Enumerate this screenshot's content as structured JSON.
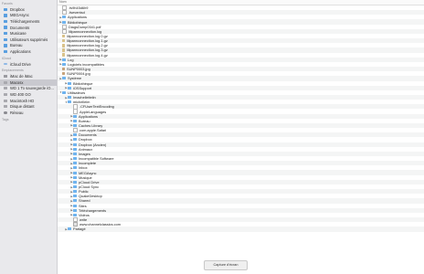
{
  "sidebar": {
    "sections": [
      {
        "label": "Favoris",
        "items": [
          {
            "label": "Dropbox",
            "icon": "folder-icon"
          },
          {
            "label": "MEGAsync",
            "icon": "folder-icon"
          },
          {
            "label": "Téléchargements",
            "icon": "download-icon"
          },
          {
            "label": "Documents",
            "icon": "document-icon"
          },
          {
            "label": "Musicase",
            "icon": "folder-icon"
          },
          {
            "label": "Utilisateurs supprimés",
            "icon": "folder-icon"
          },
          {
            "label": "Bureau",
            "icon": "desktop-icon"
          },
          {
            "label": "Applications",
            "icon": "applications-icon"
          }
        ]
      },
      {
        "label": "iCloud",
        "items": [
          {
            "label": "iCloud Drive",
            "icon": "cloud-icon"
          }
        ]
      },
      {
        "label": "Emplacements",
        "items": [
          {
            "label": "iMac de iMac",
            "icon": "computer-icon"
          },
          {
            "label": "Macosx",
            "icon": "disk-icon",
            "selected": true
          },
          {
            "label": "WD 1 To sauvegarde iO...",
            "icon": "disk-icon"
          },
          {
            "label": "WD 400 GO",
            "icon": "disk-icon"
          },
          {
            "label": "Macintosh HD",
            "icon": "disk-icon"
          },
          {
            "label": "Disque distant",
            "icon": "disk-icon"
          },
          {
            "label": "Réseau",
            "icon": "network-icon"
          }
        ]
      },
      {
        "label": "Tags",
        "items": []
      }
    ]
  },
  "header": {
    "name_column": "Nom"
  },
  "rows": [
    {
      "indent": 0,
      "disc": "",
      "icon": "file",
      "name": ".fs9h45d6h9"
    },
    {
      "indent": 0,
      "disc": "",
      "icon": "file",
      "name": ".fseventsd"
    },
    {
      "indent": 0,
      "disc": "▶",
      "icon": "folder",
      "name": "Applications"
    },
    {
      "indent": 0,
      "disc": "▶",
      "icon": "folder",
      "name": "Bibliothèque"
    },
    {
      "indent": 0,
      "disc": "",
      "icon": "file",
      "name": "DiagsDump0341.pdf"
    },
    {
      "indent": 0,
      "disc": "",
      "icon": "file",
      "name": "lilipanrconnection.log"
    },
    {
      "indent": 0,
      "disc": "",
      "icon": "archive",
      "name": "lilipanrconnection.log.0.gz"
    },
    {
      "indent": 0,
      "disc": "",
      "icon": "archive",
      "name": "lilipanrconnection.log.1.gz"
    },
    {
      "indent": 0,
      "disc": "",
      "icon": "archive",
      "name": "lilipanrconnection.log.2.gz"
    },
    {
      "indent": 0,
      "disc": "",
      "icon": "archive",
      "name": "lilipanrconnection.log.3.gz"
    },
    {
      "indent": 0,
      "disc": "",
      "icon": "archive",
      "name": "lilipanrconnection.log.4.gz"
    },
    {
      "indent": 0,
      "disc": "▶",
      "icon": "folder",
      "name": "Log"
    },
    {
      "indent": 0,
      "disc": "▶",
      "icon": "folder",
      "name": "Logiciels incompatibles"
    },
    {
      "indent": 0,
      "disc": "",
      "icon": "image",
      "name": "SUNP0003.jpg"
    },
    {
      "indent": 0,
      "disc": "",
      "icon": "image",
      "name": "SUNP0004.jpg"
    },
    {
      "indent": 0,
      "disc": "▶",
      "icon": "folder",
      "name": "Système"
    },
    {
      "indent": 1,
      "disc": "▶",
      "icon": "folder",
      "name": "Bibliothèque"
    },
    {
      "indent": 1,
      "disc": "▶",
      "icon": "folder",
      "name": "iOSSupport"
    },
    {
      "indent": 0,
      "disc": "▼",
      "icon": "folder",
      "name": "Utilisateurs"
    },
    {
      "indent": 1,
      "disc": "▶",
      "icon": "folder",
      "name": "Imachelleiteiin"
    },
    {
      "indent": 1,
      "disc": "▼",
      "icon": "folder",
      "name": "michelleim"
    },
    {
      "indent": 2,
      "disc": "",
      "icon": "file",
      "name": ".CFUserTextEncoding"
    },
    {
      "indent": 2,
      "disc": "",
      "icon": "file",
      "name": "AppleLanguages"
    },
    {
      "indent": 2,
      "disc": "▶",
      "icon": "folder",
      "name": "Applications"
    },
    {
      "indent": 2,
      "disc": "▶",
      "icon": "folder",
      "name": "Bureau"
    },
    {
      "indent": 2,
      "disc": "▶",
      "icon": "folder",
      "name": "Caches Library"
    },
    {
      "indent": 2,
      "disc": "",
      "icon": "file",
      "name": "com.apple.Safari"
    },
    {
      "indent": 2,
      "disc": "▶",
      "icon": "folder",
      "name": "Documents"
    },
    {
      "indent": 2,
      "disc": "▶",
      "icon": "folder",
      "name": "Dropbox"
    },
    {
      "indent": 2,
      "disc": "▶",
      "icon": "folder",
      "name": "Dropbox (Ancien)"
    },
    {
      "indent": 2,
      "disc": "▶",
      "icon": "folder",
      "name": "Animaux"
    },
    {
      "indent": 2,
      "disc": "▶",
      "icon": "folder",
      "name": "Images"
    },
    {
      "indent": 2,
      "disc": "▶",
      "icon": "folder",
      "name": "Incompatible Software"
    },
    {
      "indent": 2,
      "disc": "▶",
      "icon": "folder",
      "name": "Incomplete"
    },
    {
      "indent": 2,
      "disc": "▶",
      "icon": "folder",
      "name": "Inbox"
    },
    {
      "indent": 2,
      "disc": "▶",
      "icon": "folder",
      "name": "MEGAsync"
    },
    {
      "indent": 2,
      "disc": "▶",
      "icon": "folder",
      "name": "Musique"
    },
    {
      "indent": 2,
      "disc": "▶",
      "icon": "folder",
      "name": "pCloud Drive"
    },
    {
      "indent": 2,
      "disc": "▶",
      "icon": "folder",
      "name": "pCloud Sync"
    },
    {
      "indent": 2,
      "disc": "▶",
      "icon": "folder",
      "name": "Public"
    },
    {
      "indent": 2,
      "disc": "▶",
      "icon": "folder",
      "name": "QuakeDesktop"
    },
    {
      "indent": 2,
      "disc": "▶",
      "icon": "folder",
      "name": "Shared"
    },
    {
      "indent": 2,
      "disc": "▶",
      "icon": "folder",
      "name": "Sites"
    },
    {
      "indent": 2,
      "disc": "▶",
      "icon": "folder",
      "name": "Téléchargements"
    },
    {
      "indent": 2,
      "disc": "▶",
      "icon": "folder",
      "name": "Vidéos"
    },
    {
      "indent": 2,
      "disc": "",
      "icon": "file",
      "name": "write"
    },
    {
      "indent": 2,
      "disc": "",
      "icon": "web",
      "name": "www.channelclassics.com"
    },
    {
      "indent": 1,
      "disc": "▶",
      "icon": "folder",
      "name": "Partagé"
    }
  ],
  "capture_button": "Capture d'écran"
}
